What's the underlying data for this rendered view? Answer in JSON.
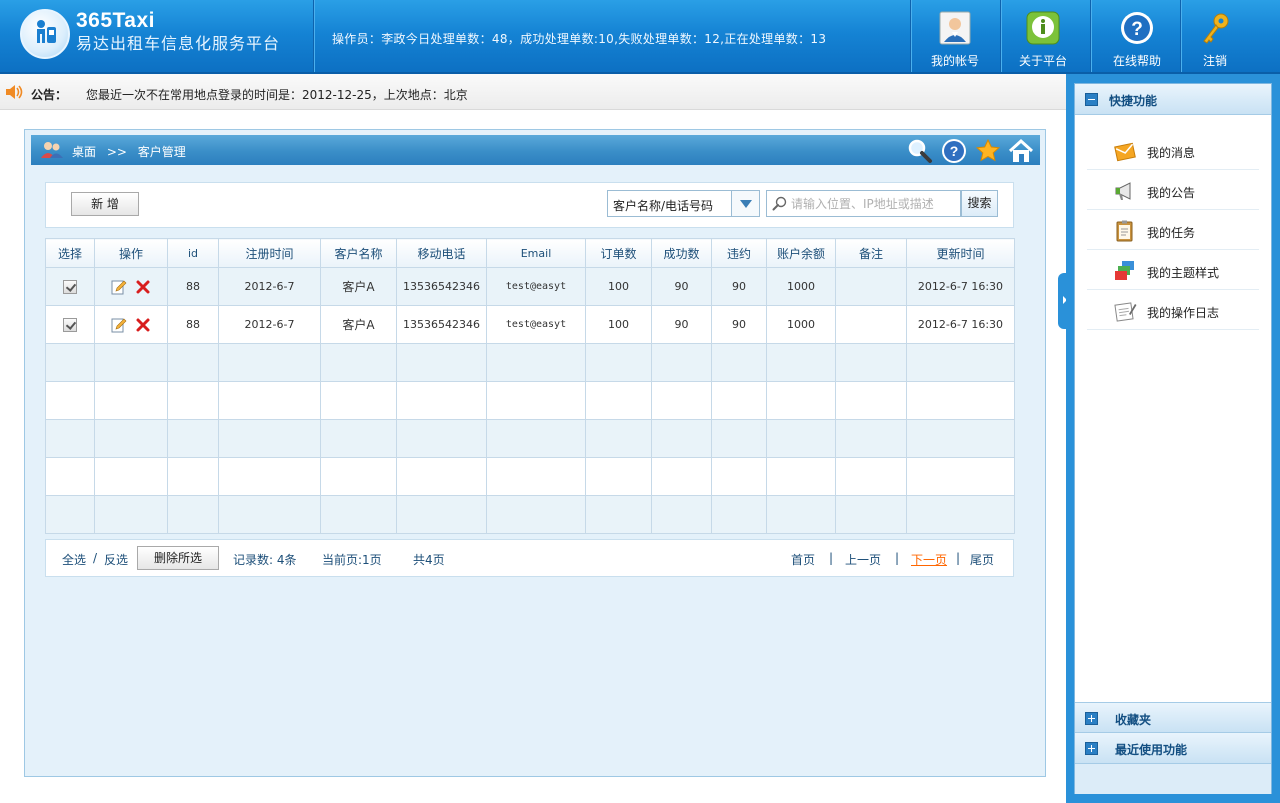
{
  "header": {
    "brand_title": "365Taxi",
    "brand_subtitle": "易达出租车信息化服务平台",
    "operator_info": "操作员：李政今日处理单数：48，成功处理单数:10,失败处理单数：12,正在处理单数：13",
    "nav": [
      {
        "label": "我的帐号",
        "icon": "user-card-icon"
      },
      {
        "label": "关于平台",
        "icon": "info-icon"
      },
      {
        "label": "在线帮助",
        "icon": "help-icon"
      },
      {
        "label": "注销",
        "icon": "key-icon"
      }
    ]
  },
  "notice": {
    "tag": "公告：",
    "message": "您最近一次不在常用地点登录的时间是：2012-12-25，上次地点：北京"
  },
  "breadcrumb": {
    "home": "桌面",
    "separator": ">>",
    "current": "客户管理"
  },
  "toolbar": {
    "add_label": "新 增",
    "select_value": "客户名称/电话号码",
    "search_placeholder": "请输入位置、IP地址或描述",
    "search_label": "搜索"
  },
  "table": {
    "columns": [
      "选择",
      "操作",
      "id",
      "注册时间",
      "客户名称",
      "移动电话",
      "Email",
      "订单数",
      "成功数",
      "违约",
      "账户余额",
      "备注",
      "更新时间"
    ],
    "rows": [
      {
        "id": "88",
        "reg_time": "2012-6-7",
        "name": "客户A",
        "phone": "13536542346",
        "email": "test@easyt",
        "orders": "100",
        "success": "90",
        "breach": "90",
        "balance": "1000",
        "remark": "",
        "updated": "2012-6-7 16:30"
      },
      {
        "id": "88",
        "reg_time": "2012-6-7",
        "name": "客户A",
        "phone": "13536542346",
        "email": "test@easyt",
        "orders": "100",
        "success": "90",
        "breach": "90",
        "balance": "1000",
        "remark": "",
        "updated": "2012-6-7 16:30"
      }
    ]
  },
  "pager": {
    "select_all": "全选",
    "divider": "/",
    "invert": "反选",
    "delete_selected": "删除所选",
    "record_count": "记录数: 4条",
    "current_page": "当前页:1页",
    "total_pages": "共4页",
    "first": "首页",
    "prev": "上一页",
    "next": "下一页",
    "last": "尾页",
    "bar": "|"
  },
  "sidebar": {
    "quick_title": "快捷功能",
    "items": [
      {
        "label": "我的消息",
        "icon": "message-icon"
      },
      {
        "label": "我的公告",
        "icon": "megaphone-icon"
      },
      {
        "label": "我的任务",
        "icon": "clipboard-icon"
      },
      {
        "label": "我的主题样式",
        "icon": "theme-icon"
      },
      {
        "label": "我的操作日志",
        "icon": "log-icon"
      }
    ],
    "favorites_title": "收藏夹",
    "recent_title": "最近使用功能"
  }
}
